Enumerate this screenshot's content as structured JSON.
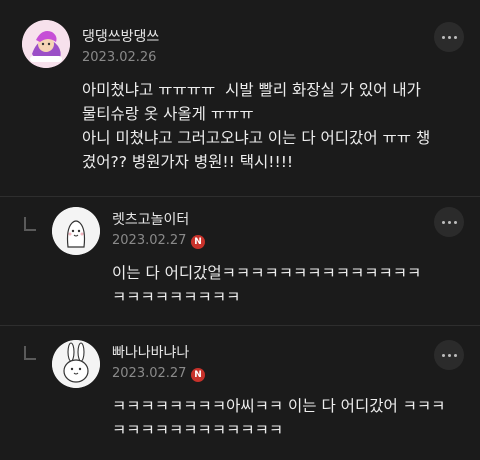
{
  "comments": [
    {
      "nickname": "댕댕쓰방댕쓰",
      "date": "2023.02.26",
      "text": "아미쳤냐고 ㅠㅠㅠㅠ  시발 빨리 화장실 가 있어 내가\n물티슈랑 옷 사올게 ㅠㅠㅠ\n아니 미쳤냐고 그러고오냐고 이는 다 어디갔어 ㅠㅠ 챙\n겼어?? 병원가자 병원!! 택시!!!!",
      "badge": ""
    },
    {
      "nickname": "렛츠고놀이터",
      "date": "2023.02.27",
      "text": "이는 다 어디갔얼ㅋㅋㅋㅋㅋㅋㅋㅋㅋㅋㅋㅋㅋㅋ\nㅋㅋㅋㅋㅋㅋㅋㅋㅋ",
      "badge": "N"
    },
    {
      "nickname": "빠나나바냐나",
      "date": "2023.02.27",
      "text": "ㅋㅋㅋㅋㅋㅋㅋㅋ아씨ㅋㅋ 이는 다 어디갔어 ㅋㅋㅋ\nㅋㅋㅋㅋㅋㅋㅋㅋㅋㅋㅋㅋ",
      "badge": "N"
    }
  ],
  "colors": {
    "background": "#1b1b1b",
    "badge": "#c8322b",
    "text": "#ededed",
    "muted": "#8a8a8a"
  },
  "icons": {
    "more": "more-dots-icon",
    "reply": "reply-arrow-icon"
  }
}
